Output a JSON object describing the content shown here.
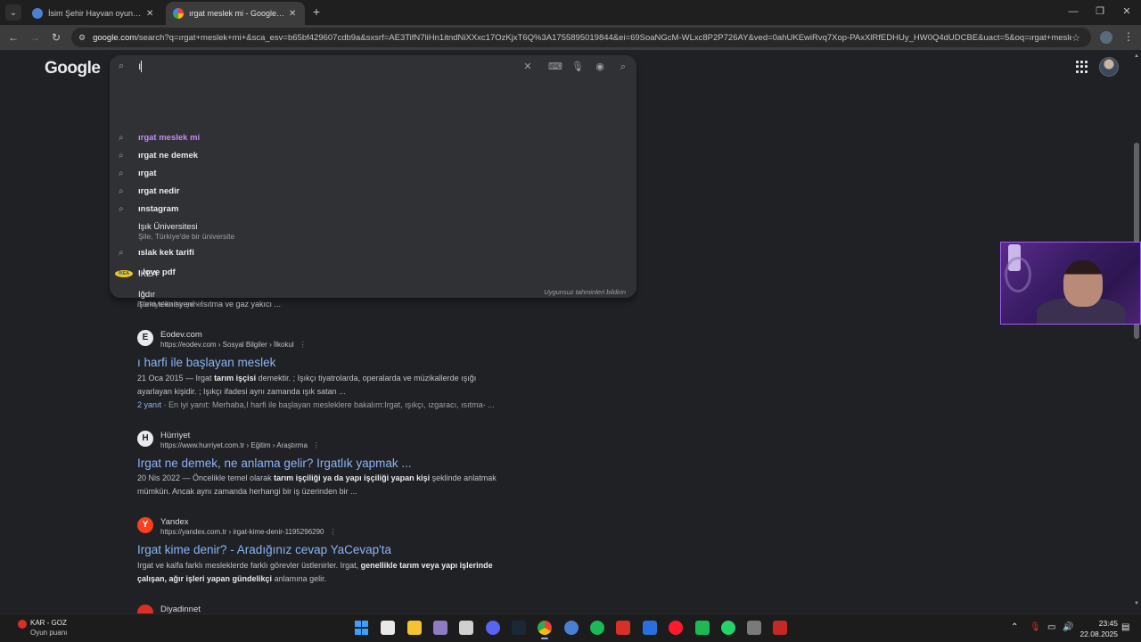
{
  "browser": {
    "tabs": [
      {
        "title": "İsim Şehir Hayvan oyununa katıl",
        "active": false,
        "favicon_color": "#4a7fd4"
      },
      {
        "title": "ırgat meslek mi - Google'da Ara",
        "active": true,
        "favicon_color": "#4285f4"
      }
    ],
    "url_domain": "google.com",
    "url_rest": "/search?q=ırgat+meslek+mi+&sca_esv=b65bf429607cdb9a&sxsrf=AE3TifN7liHn1itndNiXXxc17OzKjxT6Q%3A1755895019844&ei=69SoaNGcM-WLxc8P2P726AY&ved=0ahUKEwiRvq7Xop-PAxXlRfEDHUy_HW0Q4dUDCBE&uact=5&oq=ırgat+meslek+mi..."
  },
  "google": {
    "logo": "Google",
    "query": "ı",
    "suggestions": [
      {
        "text": "ırgat meslek mi",
        "type": "search",
        "visited": true
      },
      {
        "text": "ırgat ne demek",
        "type": "search",
        "visited": false
      },
      {
        "text": "ırgat",
        "type": "search",
        "visited": false
      },
      {
        "text": "ırgat nedir",
        "type": "search",
        "visited": false
      },
      {
        "text": "ınstagram",
        "type": "search",
        "visited": false
      },
      {
        "text": "Işık Üniversitesi",
        "subtitle": "Şile, Türkiye'de bir üniversite",
        "type": "entity",
        "visited": false
      },
      {
        "text": "ıslak kek tarifi",
        "type": "search",
        "visited": false
      },
      {
        "text": "IKEA",
        "type": "brand",
        "visited": false
      },
      {
        "text": "Iğdır",
        "subtitle": "Türkiye'de bir şehir",
        "type": "entity",
        "visited": false
      },
      {
        "text": "ı love pdf",
        "type": "search",
        "visited": false
      }
    ],
    "report_link": "Uygunsuz tahminleri bildirin",
    "ikea_logo_text": "IKEA"
  },
  "results": {
    "partial_snippet": "işlem teknisyeni · Isıtma ve gaz yakıcı ...",
    "items": [
      {
        "favicon": "E",
        "favicon_bg": "#e8eaed",
        "site": "Eodev.com",
        "cite": "https://eodev.com › Sosyal Bilgiler › İlkokul",
        "title": "ı harfi ile başlayan meslek",
        "snippet1_pre": "21 Oca 2015 — Irgat ",
        "snippet1_bold": "tarım işçisi",
        "snippet1_post": " demektir. ; Işıkçı tiyatrolarda, operalarda ve müzikallerde ışığı",
        "snippet2": "ayarlayan kişidir. ; Işıkçı ifadesi aynı zamanda ışık satan ...",
        "answers_link": "2 yanıt",
        "answers_text": " · En iyi yanıt: Merhaba,I harfi ile başlayan mesleklere bakalım:Irgat, ışıkçı, ızgaracı, ısıtma- ..."
      },
      {
        "favicon": "H",
        "favicon_bg": "#e8eaed",
        "site": "Hürriyet",
        "cite": "https://www.hurriyet.com.tr › Eğitim › Araştırma",
        "title": "Irgat ne demek, ne anlama gelir? Irgatlık yapmak ...",
        "snippet1_pre": "20 Nis 2022 — Öncelikle temel olarak ",
        "snippet1_bold": "tarım işçiliği ya da yapı işçiliği yapan kişi",
        "snippet1_post": " şeklinde anlatmak",
        "snippet2": "mümkün. Ancak aynı zamanda herhangi bir iş üzerinden bir ..."
      },
      {
        "favicon": "Y",
        "favicon_bg": "#fc3f1d",
        "site": "Yandex",
        "cite": "https://yandex.com.tr › irgat-kime-denir-1195296290",
        "title": "Irgat kime denir? - Aradığınız cevap YaCevap'ta",
        "snippet1_pre": "Irgat ve kalfa farklı mesleklerde farklı görevler üstlenirler. Irgat, ",
        "snippet1_bold": "genellikle tarım veya yapı işlerinde",
        "snippet1_post": "",
        "snippet2_bold": "çalışan, ağır işleri yapan gündelikçi",
        "snippet2_post": " anlamına gelir."
      },
      {
        "site": "Diyadinnet"
      }
    ]
  },
  "taskbar": {
    "status_line1": "KAR - GOZ",
    "status_line2": "Oyun puanı",
    "time": "23:45",
    "date": "22.08.2025"
  },
  "colors": {
    "page_bg": "#202124",
    "link": "#8ab4f8",
    "visited": "#c58af9",
    "webcam_border": "#a35cf7"
  }
}
